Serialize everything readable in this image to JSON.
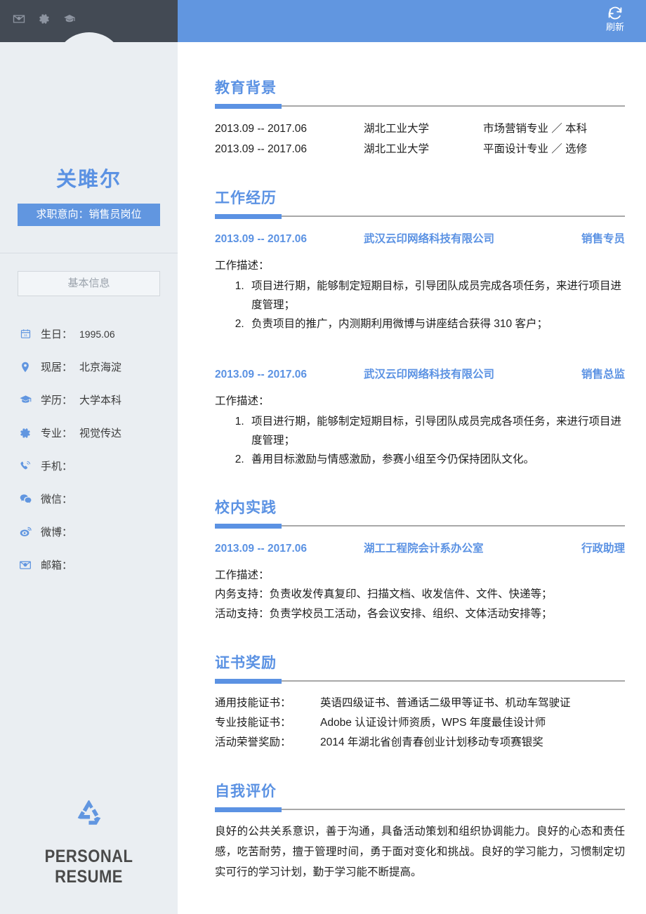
{
  "topbar": {
    "icons": [
      {
        "name": "envelope-icon",
        "label": "邮件"
      },
      {
        "name": "gear-icon",
        "label": "设置"
      },
      {
        "name": "graduation-cap-icon",
        "label": "学历"
      }
    ],
    "refresh": {
      "icon": "refresh-icon",
      "label": "刷新"
    },
    "colors": {
      "dark": "#434a54",
      "blue": "#6196e0"
    }
  },
  "sidebar": {
    "name": "关雎尔",
    "job_intention": "求职意向：销售员岗位",
    "basic_info_label": "基本信息",
    "info_items": [
      {
        "icon": "calendar-icon",
        "label": "生日：",
        "value": "1995.06"
      },
      {
        "icon": "location-pin-icon",
        "label": "现居：",
        "value": "北京海淀"
      },
      {
        "icon": "graduation-cap-icon",
        "label": "学历：",
        "value": "大学本科"
      },
      {
        "icon": "gear-icon",
        "label": "专业：",
        "value": "视觉传达"
      },
      {
        "icon": "phone-icon",
        "label": "手机：",
        "value": ""
      },
      {
        "icon": "wechat-icon",
        "label": "微信：",
        "value": ""
      },
      {
        "icon": "weibo-icon",
        "label": "微博：",
        "value": ""
      },
      {
        "icon": "envelope-icon",
        "label": "邮箱：",
        "value": ""
      }
    ],
    "footer": {
      "icon": "recycle-icon",
      "brand": "PERSONAL RESUME"
    },
    "colors": {
      "background": "#eaeef2",
      "accent": "#6196e0",
      "name_color": "#5b92e3"
    }
  },
  "main": {
    "education": {
      "title": "教育背景",
      "rows": [
        {
          "date": "2013.09 -- 2017.06",
          "school": "湖北工业大学",
          "major": "市场营销专业 ／ 本科"
        },
        {
          "date": "2013.09 -- 2017.06",
          "school": "湖北工业大学",
          "major": "平面设计专业 ／ 选修"
        }
      ]
    },
    "work": {
      "title": "工作经历",
      "entries": [
        {
          "date": "2013.09 -- 2017.06",
          "company": "武汉云印网络科技有限公司",
          "role": "销售专员",
          "desc_label": "工作描述：",
          "items": [
            "项目进行期，能够制定短期目标，引导团队成员完成各项任务，来进行项目进度管理；",
            "负责项目的推广，内测期利用微博与讲座结合获得 310 客户；"
          ]
        },
        {
          "date": "2013.09 -- 2017.06",
          "company": "武汉云印网络科技有限公司",
          "role": "销售总监",
          "desc_label": "工作描述：",
          "items": [
            "项目进行期，能够制定短期目标，引导团队成员完成各项任务，来进行项目进度管理；",
            "善用目标激励与情感激励，参赛小组至今仍保持团队文化。"
          ]
        }
      ]
    },
    "campus": {
      "title": "校内实践",
      "entry": {
        "date": "2013.09 -- 2017.06",
        "company": "湖工工程院会计系办公室",
        "role": "行政助理",
        "desc_label": "工作描述：",
        "lines": [
          "内务支持：负责收发传真复印、扫描文档、收发信件、文件、快递等；",
          "活动支持：负责学校员工活动，各会议安排、组织、文体活动安排等；"
        ]
      }
    },
    "certificates": {
      "title": "证书奖励",
      "rows": [
        {
          "key": "通用技能证书：",
          "value": "英语四级证书、普通话二级甲等证书、机动车驾驶证"
        },
        {
          "key": "专业技能证书：",
          "value": "Adobe 认证设计师资质，WPS 年度最佳设计师"
        },
        {
          "key": "活动荣誉奖励：",
          "value": "2014 年湖北省创青春创业计划移动专项赛银奖"
        }
      ]
    },
    "evaluation": {
      "title": "自我评价",
      "text": "良好的公共关系意识，善于沟通，具备活动策划和组织协调能力。良好的心态和责任感，吃苦耐劳，擅于管理时间，勇于面对变化和挑战。良好的学习能力，习惯制定切实可行的学习计划，勤于学习能不断提高。"
    },
    "colors": {
      "heading": "#5b92e3",
      "rule_accent": "#5b92e3",
      "rule_line": "#a8a8a8",
      "body_text": "#1d1d1d"
    }
  }
}
